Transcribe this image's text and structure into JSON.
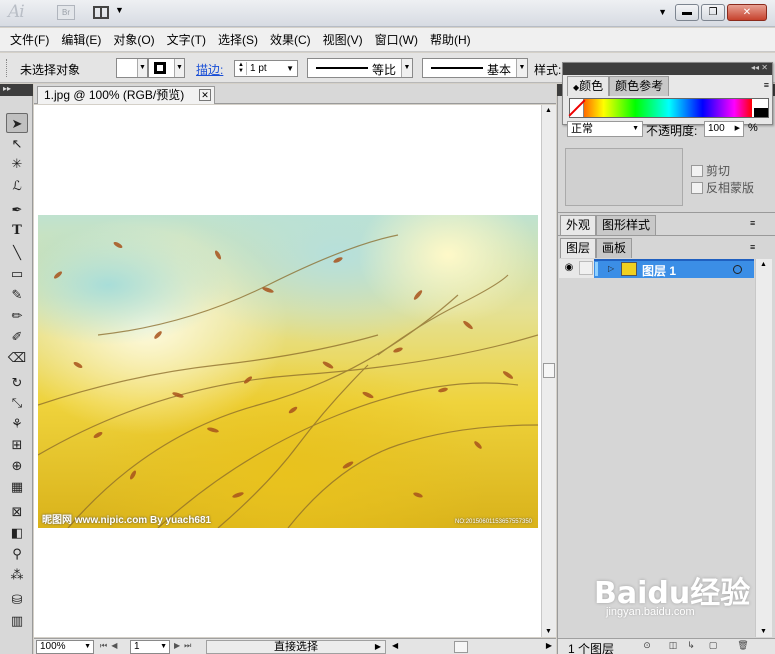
{
  "app": {
    "logo": "Ai",
    "bridge": "Br"
  },
  "menu": [
    "文件(F)",
    "编辑(E)",
    "对象(O)",
    "文字(T)",
    "选择(S)",
    "效果(C)",
    "视图(V)",
    "窗口(W)",
    "帮助(H)"
  ],
  "control_bar": {
    "selection_label": "未选择对象",
    "stroke_label": "描边:",
    "stroke_weight": "1 pt",
    "profile_label": "等比",
    "brush_label": "基本",
    "style_label": "样式:"
  },
  "document_tab": {
    "title": "1.jpg @ 100% (RGB/预览)"
  },
  "photo": {
    "watermark_left": "昵图网 www.nipic.com   By yuach681",
    "watermark_right": "NO:20150601153657557350"
  },
  "status_bar": {
    "zoom": "100%",
    "page": "1",
    "tool": "直接选择"
  },
  "color_panel": {
    "tabs": [
      "颜色",
      "颜色参考"
    ]
  },
  "transparency": {
    "blend_mode": "正常",
    "opacity_label": "不透明度:",
    "opacity_value": "100",
    "percent": "%",
    "clip_label": "剪切",
    "invert_label": "反相蒙版"
  },
  "appearance_tabs": [
    "外观",
    "图形样式"
  ],
  "layers_tabs": [
    "图层",
    "画板"
  ],
  "layers": [
    {
      "name": "图层 1"
    }
  ],
  "layers_footer": {
    "count": "1 个图层"
  },
  "watermark": {
    "main": "Baidu经验",
    "url": "jingyan.baidu.com"
  },
  "colors": {
    "selection_blue": "#3b8ee6",
    "stroke_link": "#1a4fd6"
  }
}
